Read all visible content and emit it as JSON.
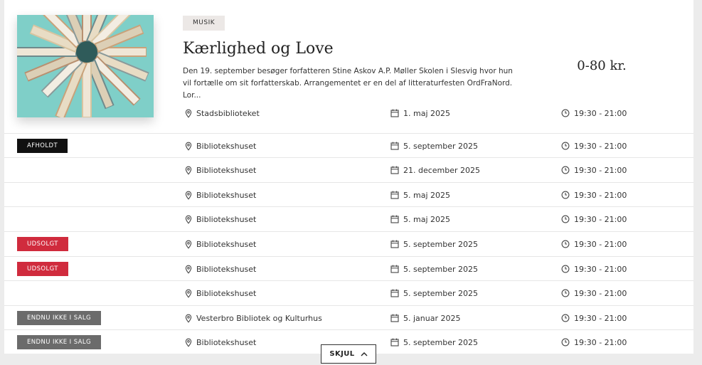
{
  "event": {
    "category": "MUSIK",
    "title": "Kærlighed og Love",
    "description": "Den 19. september besøger forfatteren Stine Askov A.P. Møller Skolen i Slesvig hvor hun vil fortælle om sit forfatterskab. Arrangementet er en del af litteraturfesten OrdFraNord. Lor...",
    "price": "0-80 kr.",
    "image_alt": "books arranged in a circle on a turquoise background"
  },
  "occurrences": [
    {
      "badge": "",
      "location": "Stadsbiblioteket",
      "date": "1. maj 2025",
      "time": "19:30 - 21:00"
    },
    {
      "badge": "AFHOLDT",
      "badge_type": "held",
      "location": "Bibliotekshuset",
      "date": "5. september 2025",
      "time": "19:30 - 21:00"
    },
    {
      "badge": "",
      "location": "Bibliotekshuset",
      "date": "21. december 2025",
      "time": "19:30 - 21:00"
    },
    {
      "badge": "",
      "location": "Bibliotekshuset",
      "date": "5. maj 2025",
      "time": "19:30 - 21:00"
    },
    {
      "badge": "",
      "location": "Bibliotekshuset",
      "date": "5. maj 2025",
      "time": "19:30 - 21:00"
    },
    {
      "badge": "UDSOLGT",
      "badge_type": "sold",
      "location": "Bibliotekshuset",
      "date": "5. september 2025",
      "time": "19:30 - 21:00"
    },
    {
      "badge": "UDSOLGT",
      "badge_type": "sold",
      "location": "Bibliotekshuset",
      "date": "5. september 2025",
      "time": "19:30 - 21:00"
    },
    {
      "badge": "",
      "location": "Bibliotekshuset",
      "date": "5. september 2025",
      "time": "19:30 - 21:00"
    },
    {
      "badge": "ENDNU IKKE I SALG",
      "badge_type": "notyet",
      "location": "Vesterbro Bibliotek og Kulturhus",
      "date": "5. januar 2025",
      "time": "19:30 - 21:00"
    },
    {
      "badge": "ENDNU IKKE I SALG",
      "badge_type": "notyet",
      "location": "Bibliotekshuset",
      "date": "5. september 2025",
      "time": "19:30 - 21:00"
    }
  ],
  "controls": {
    "hide_label": "SKJUL"
  },
  "colors": {
    "badge_held": "#111111",
    "badge_sold": "#d02b3d",
    "badge_notyet": "#6b6b6b",
    "thumb_background": "#7fcfc8"
  },
  "icons": {
    "location": "map-pin-icon",
    "date": "calendar-icon",
    "time": "clock-icon",
    "hide": "chevron-up-icon"
  }
}
